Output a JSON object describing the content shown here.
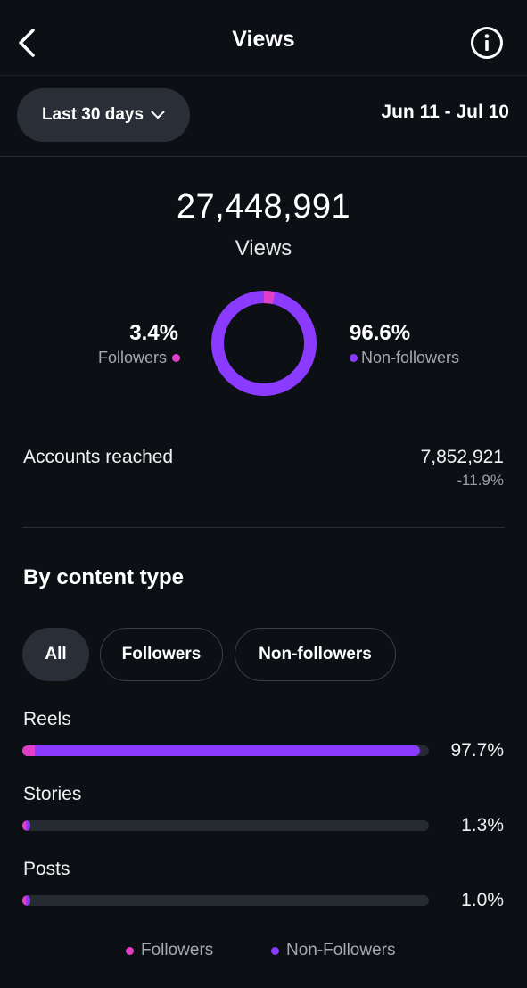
{
  "header": {
    "title": "Views",
    "back_icon": "chevron-left-icon",
    "info_icon": "info-icon"
  },
  "filters": {
    "range_label": "Last 30 days",
    "date_range": "Jun 11 - Jul 10"
  },
  "summary": {
    "total": "27,448,991",
    "total_label": "Views",
    "followers_pct": "3.4%",
    "followers_label": "Followers",
    "non_followers_pct": "96.6%",
    "non_followers_label": "Non-followers",
    "followers_fraction": 0.034,
    "non_followers_fraction": 0.966
  },
  "reach": {
    "label": "Accounts reached",
    "value": "7,852,921",
    "change": "-11.9%"
  },
  "content_type": {
    "title": "By content type",
    "chips": [
      "All",
      "Followers",
      "Non-followers"
    ],
    "selected_chip": "All",
    "rows": [
      {
        "label": "Reels",
        "pct": "97.7%",
        "followers_share": 0.03,
        "nonfollowers_share": 0.977
      },
      {
        "label": "Stories",
        "pct": "1.3%",
        "followers_share": 0.005,
        "nonfollowers_share": 0.013
      },
      {
        "label": "Posts",
        "pct": "1.0%",
        "followers_share": 0.004,
        "nonfollowers_share": 0.01
      }
    ]
  },
  "legend": {
    "followers": "Followers",
    "non_followers": "Non-Followers"
  },
  "colors": {
    "followers": "#e040c8",
    "non_followers": "#8b3bff",
    "background": "#0c0f14"
  }
}
